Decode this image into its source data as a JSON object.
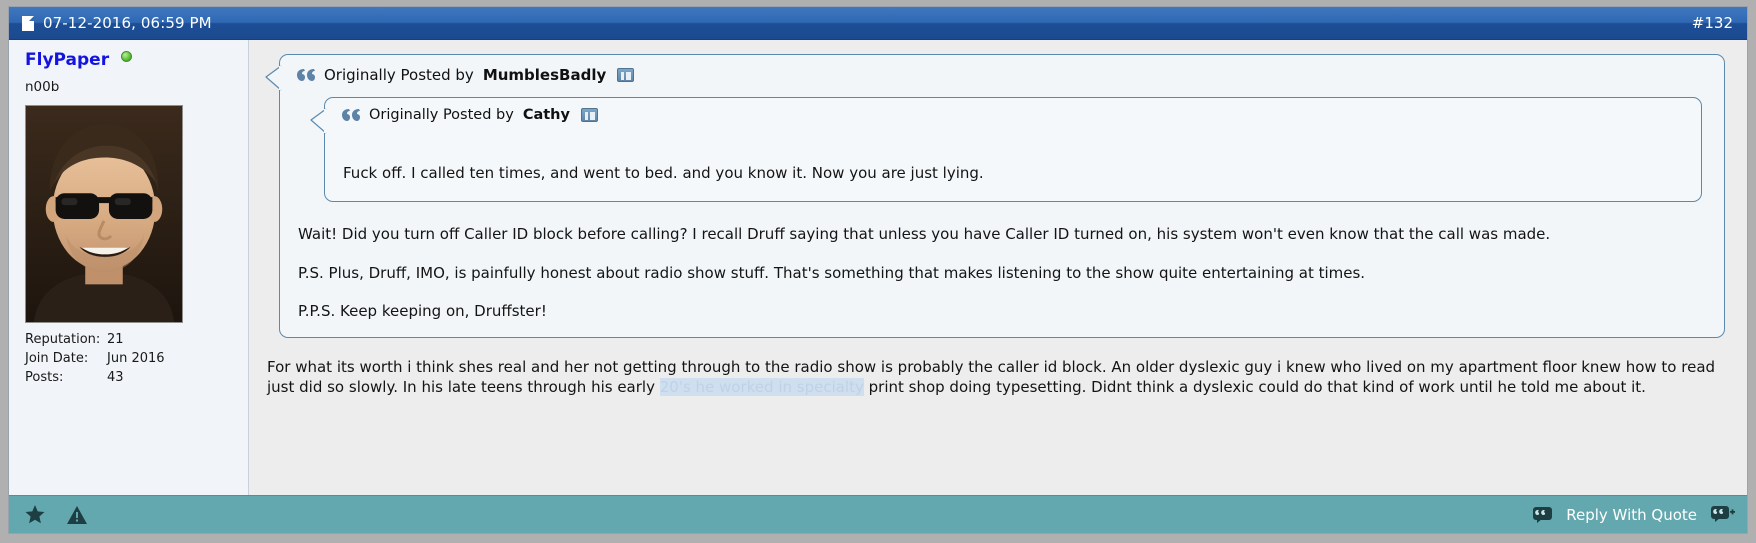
{
  "header": {
    "date": "07-12-2016, 06:59 PM",
    "post_number": "#132",
    "doc_icon": "document-icon",
    "bg_color": "#2f68b3"
  },
  "user": {
    "name": "FlyPaper",
    "online_status_icon": "online-indicator-icon",
    "title": "n00b",
    "avatar_alt": "avatar-image",
    "stats": [
      {
        "label": "Reputation:",
        "value": "21"
      },
      {
        "label": "Join Date:",
        "value": "Jun 2016"
      },
      {
        "label": "Posts:",
        "value": "43"
      }
    ]
  },
  "quotes": {
    "outer": {
      "prefix": "Originally Posted by",
      "author": "MumblesBadly",
      "quote_icon": "quotation-marks-icon",
      "view_post_icon": "view-post-icon",
      "paragraphs": [
        "Wait! Did you turn off Caller ID block before calling? I recall Druff saying that unless you have Caller ID turned on, his system won't even know that the call was made.",
        "P.S. Plus, Druff, IMO, is painfully honest about radio show stuff. That's something that makes listening to the show quite entertaining at times.",
        "P.P.S. Keep keeping on, Druffster!"
      ]
    },
    "inner": {
      "prefix": "Originally Posted by",
      "author": "Cathy",
      "quote_icon": "quotation-marks-icon",
      "view_post_icon": "view-post-icon",
      "text": "Fuck off. I called ten times, and went to bed. and you know it. Now you are just lying."
    }
  },
  "message": {
    "part1": "For what its worth i think shes real and her not getting through to the radio show is probably the caller id block. An older dyslexic guy i knew who lived on my apartment floor knew how to read just did so slowly. In his late teens through his early ",
    "highlighted": "20's he worked in specialty",
    "part2": " print shop doing typesetting. Didnt think a dyslexic could do that kind of work until he told me about it."
  },
  "footer": {
    "reply_with_quote_label": "Reply With Quote",
    "star_icon": "star-icon",
    "warning_icon": "warning-triangle-icon",
    "quote-icon": "quote-bubble-icon",
    "multiquote_icon": "multi-quote-icon",
    "bg_color": "#63a8ae"
  }
}
